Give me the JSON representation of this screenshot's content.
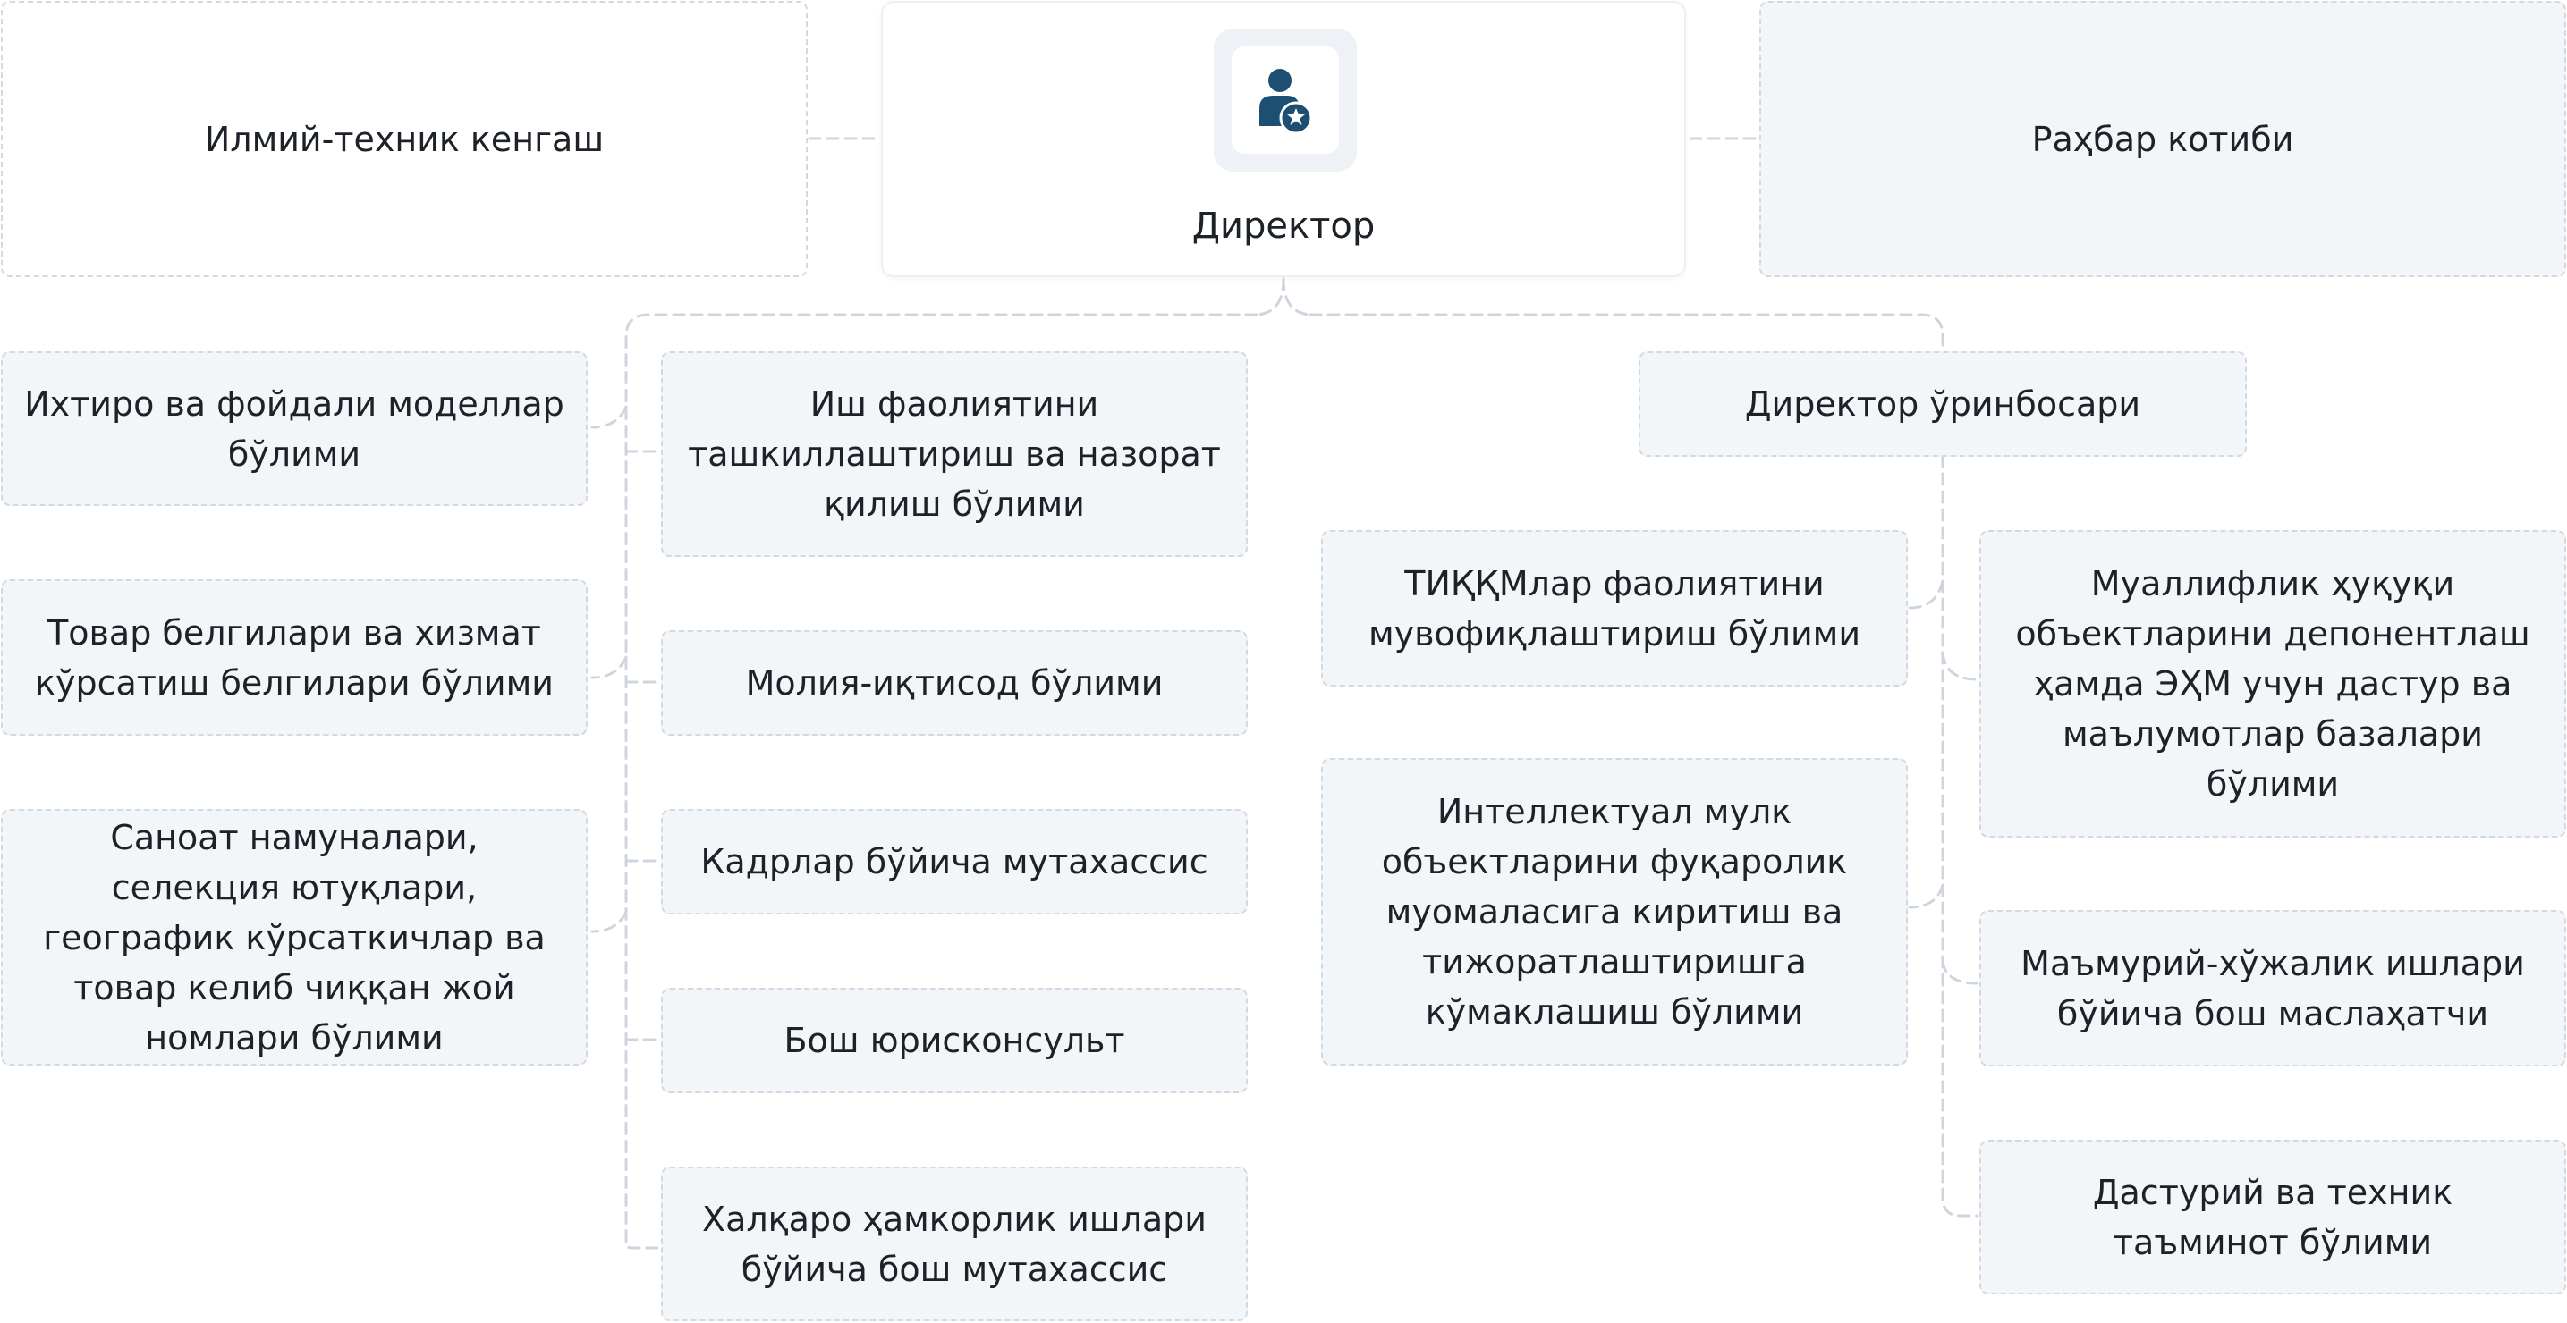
{
  "director": {
    "title": "Директор",
    "icon": "user-star-icon"
  },
  "council": "Илмий-техник кенгаш",
  "secretary": "Раҳбар котиби",
  "deputy": "Директор ўринбосари",
  "left_units": [
    "Ихтиро ва фойдали моделлар бўлими",
    "Товар белгилари ва хизмат кўрсатиш белгилари бўлими",
    "Саноат намуналари, селекция ютуқлари, географик кўрсаткичлар ва товар келиб чиққан жой номлари бўлими"
  ],
  "center_units": [
    "Иш фаолиятини ташкиллаштириш ва назорат қилиш бўлими",
    "Молия-иқтисод бўлими",
    "Кадрлар бўйича мутахассис",
    "Бош юрисконсульт",
    "Халқаро ҳамкорлик ишлари бўйича бош мутахассис"
  ],
  "deputy_left_units": [
    "ТИҚҚМлар фаолиятини мувофиқлаштириш бўлими",
    "Интеллектуал мулк объектларини фуқаролик муомаласига киритиш ва тижоратлаштиришга кўмаклашиш бўлими"
  ],
  "deputy_right_units": [
    "Муаллифлик ҳуқуқи объектларини депонентлаш ҳамда ЭҲМ учун дастур ва маълумотлар базалари бўлими",
    "Маъмурий-хўжалик ишлари бўйича бош маслаҳатчи",
    "Дастурий ва техник таъминот бўлими"
  ],
  "colors": {
    "accent": "#1d4f73",
    "box_bg": "#f3f6f9",
    "border": "#d3d9e1",
    "line": "#cfd5de"
  }
}
